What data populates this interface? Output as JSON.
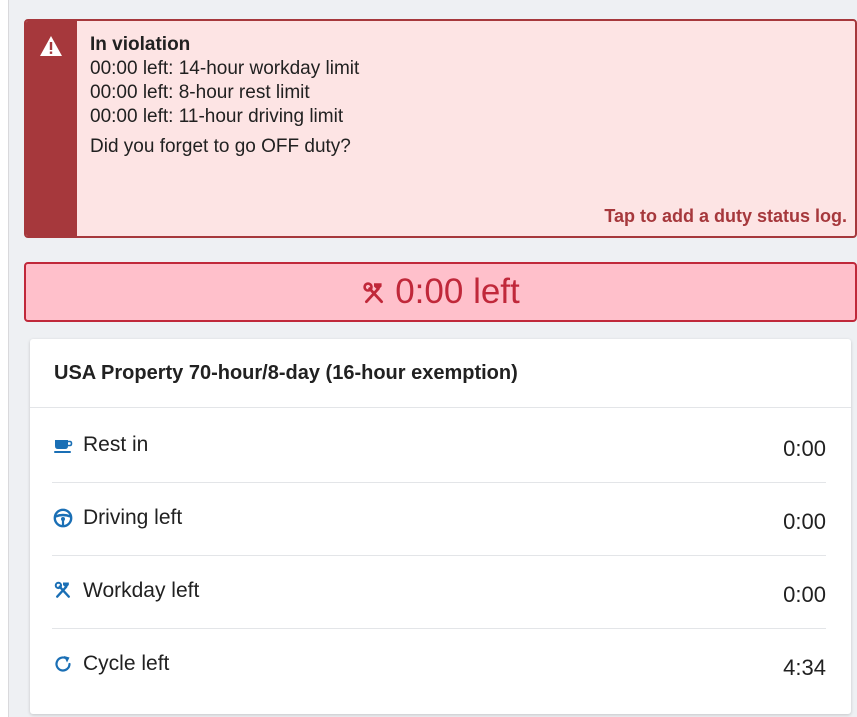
{
  "colors": {
    "alert_accent": "#a6383c",
    "alert_background": "#fde4e4",
    "banner_text": "#c0283a",
    "banner_background": "#ffc0cb",
    "icon_blue": "#1a6fb5"
  },
  "alert": {
    "icon": "warning-icon",
    "title": "In violation",
    "lines": [
      "00:00 left: 14-hour workday limit",
      "00:00 left: 8-hour rest limit",
      "00:00 left: 11-hour driving limit"
    ],
    "question": "Did you forget to go OFF duty?",
    "action": "Tap to add a duty status log."
  },
  "banner": {
    "icon": "hammer-wrench-icon",
    "text": "0:00 left"
  },
  "card": {
    "title": "USA Property 70-hour/8-day (16-hour exemption)",
    "rows": [
      {
        "icon": "coffee-cup-icon",
        "label": "Rest in",
        "value": "0:00"
      },
      {
        "icon": "steering-wheel-icon",
        "label": "Driving left",
        "value": "0:00"
      },
      {
        "icon": "hammer-wrench-icon",
        "label": "Workday left",
        "value": "0:00"
      },
      {
        "icon": "cycle-arrow-icon",
        "label": "Cycle left",
        "value": "4:34"
      }
    ]
  }
}
